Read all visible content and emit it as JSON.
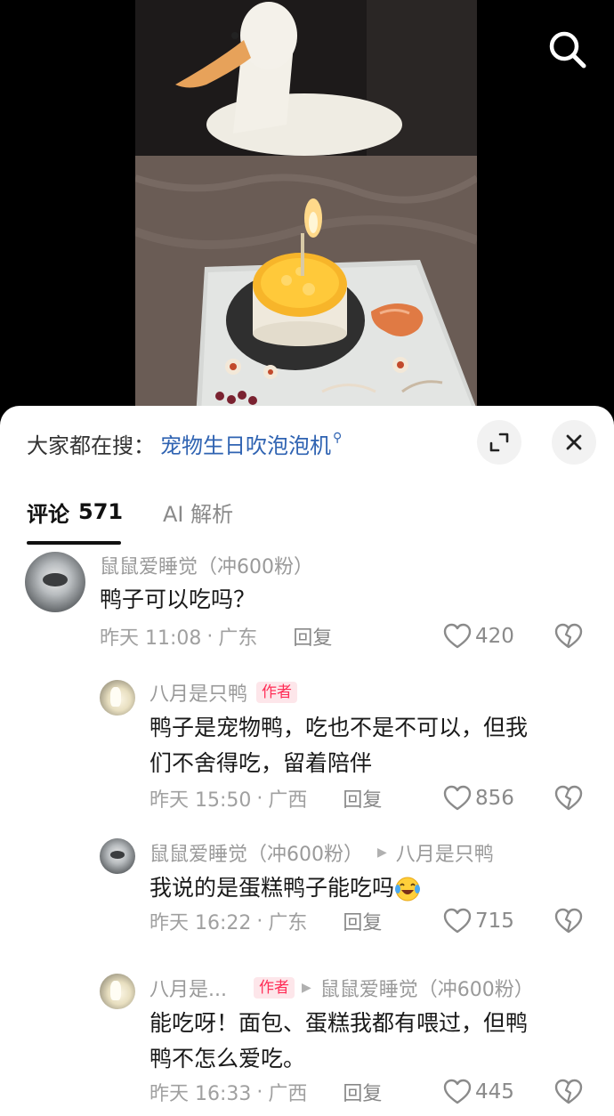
{
  "trending": {
    "label": "大家都在搜：",
    "query": "宠物生日吹泡泡机"
  },
  "tabs": {
    "comments_label": "评论",
    "comments_count": "571",
    "ai_label": "AI 解析"
  },
  "comments": [
    {
      "name": "鼠鼠爱睡觉（冲600粉）",
      "text": "鸭子可以吃吗？",
      "time": "昨天 11:08",
      "location": "广东",
      "reply": "回复",
      "likes": "420"
    },
    {
      "name": "八月是只鸭",
      "badge": "作者",
      "text_line1": "鸭子是宠物鸭，吃也不是不可以，但我",
      "text_line2": "们不舍得吃，留着陪伴",
      "time": "昨天 15:50",
      "location": "广西",
      "reply": "回复",
      "likes": "856"
    },
    {
      "name": "鼠鼠爱睡觉（冲600粉）",
      "reply_to": "八月是只鸭",
      "text": "我说的是蛋糕鸭子能吃吗",
      "time": "昨天 16:22",
      "location": "广东",
      "reply": "回复",
      "likes": "715"
    },
    {
      "name": "八月是...",
      "badge": "作者",
      "reply_to": "鼠鼠爱睡觉（冲600粉）",
      "text_line1": "能吃呀！面包、蛋糕我都有喂过，但鸭",
      "text_line2": "鸭不怎么爱吃。",
      "time": "昨天 16:33",
      "location": "广西",
      "reply": "回复",
      "likes": "445"
    }
  ],
  "separator": "·",
  "colors": {
    "link_blue": "#2f63b2",
    "author_red": "#ff2e57",
    "muted_gray": "#a0a0a0"
  },
  "icons": [
    "search-icon",
    "expand-icon",
    "close-icon",
    "heart-icon",
    "broken-heart-icon",
    "laughing-crying-emoji"
  ]
}
